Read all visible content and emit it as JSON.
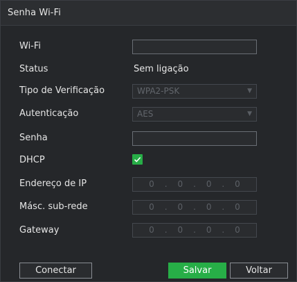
{
  "dialog": {
    "title": "Senha Wi-Fi"
  },
  "form": {
    "wifi": {
      "label": "Wi-Fi",
      "value": ""
    },
    "status": {
      "label": "Status",
      "value": "Sem ligação"
    },
    "verification": {
      "label": "Tipo de Verificação",
      "selected": "WPA2-PSK",
      "enabled": false
    },
    "authentication": {
      "label": "Autenticação",
      "selected": "AES",
      "enabled": false
    },
    "password": {
      "label": "Senha",
      "value": ""
    },
    "dhcp": {
      "label": "DHCP",
      "checked": true
    },
    "ip_address": {
      "label": "Endereço de IP",
      "octets": [
        "0",
        "0",
        "0",
        "0"
      ],
      "enabled": false
    },
    "subnet_mask": {
      "label": "Másc. sub-rede",
      "octets": [
        "0",
        "0",
        "0",
        "0"
      ],
      "enabled": false
    },
    "gateway": {
      "label": "Gateway",
      "octets": [
        "0",
        "0",
        "0",
        "0"
      ],
      "enabled": false
    },
    "ip_separator": "."
  },
  "buttons": {
    "connect": "Conectar",
    "save": "Salvar",
    "back": "Voltar"
  },
  "icons": {
    "dropdown": "chevron-down-icon",
    "check": "checkmark-icon"
  },
  "colors": {
    "accent": "#27ae47",
    "background": "#25272a",
    "text": "#e6e6e6"
  }
}
